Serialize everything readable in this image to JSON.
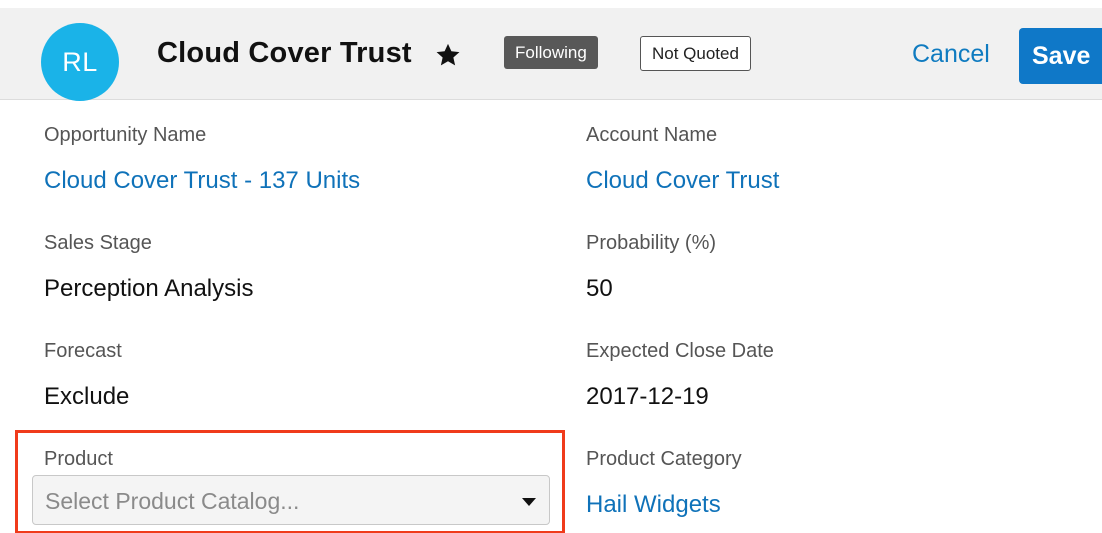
{
  "header": {
    "avatar_initials": "RL",
    "title": "Cloud Cover Trust",
    "favorite_icon": "star-icon",
    "following_label": "Following",
    "quote_status_label": "Not Quoted",
    "cancel_label": "Cancel",
    "save_label": "Save"
  },
  "fields": {
    "opportunity_name": {
      "label": "Opportunity Name",
      "value": "Cloud Cover Trust - 137 Units"
    },
    "account_name": {
      "label": "Account Name",
      "value": "Cloud Cover Trust"
    },
    "sales_stage": {
      "label": "Sales Stage",
      "value": "Perception Analysis"
    },
    "probability": {
      "label": "Probability (%)",
      "value": "50"
    },
    "forecast": {
      "label": "Forecast",
      "value": "Exclude"
    },
    "expected_close_date": {
      "label": "Expected Close Date",
      "value": "2017-12-19"
    },
    "product": {
      "label": "Product",
      "placeholder": "Select Product Catalog...",
      "icon": "caret-down-icon"
    },
    "product_category": {
      "label": "Product Category",
      "value": "Hail Widgets"
    }
  },
  "colors": {
    "avatar": "#1ab3e8",
    "link": "#0f72b9",
    "save_button": "#0f78c8",
    "highlight_border": "#f03b1b",
    "following_badge": "#585858"
  }
}
